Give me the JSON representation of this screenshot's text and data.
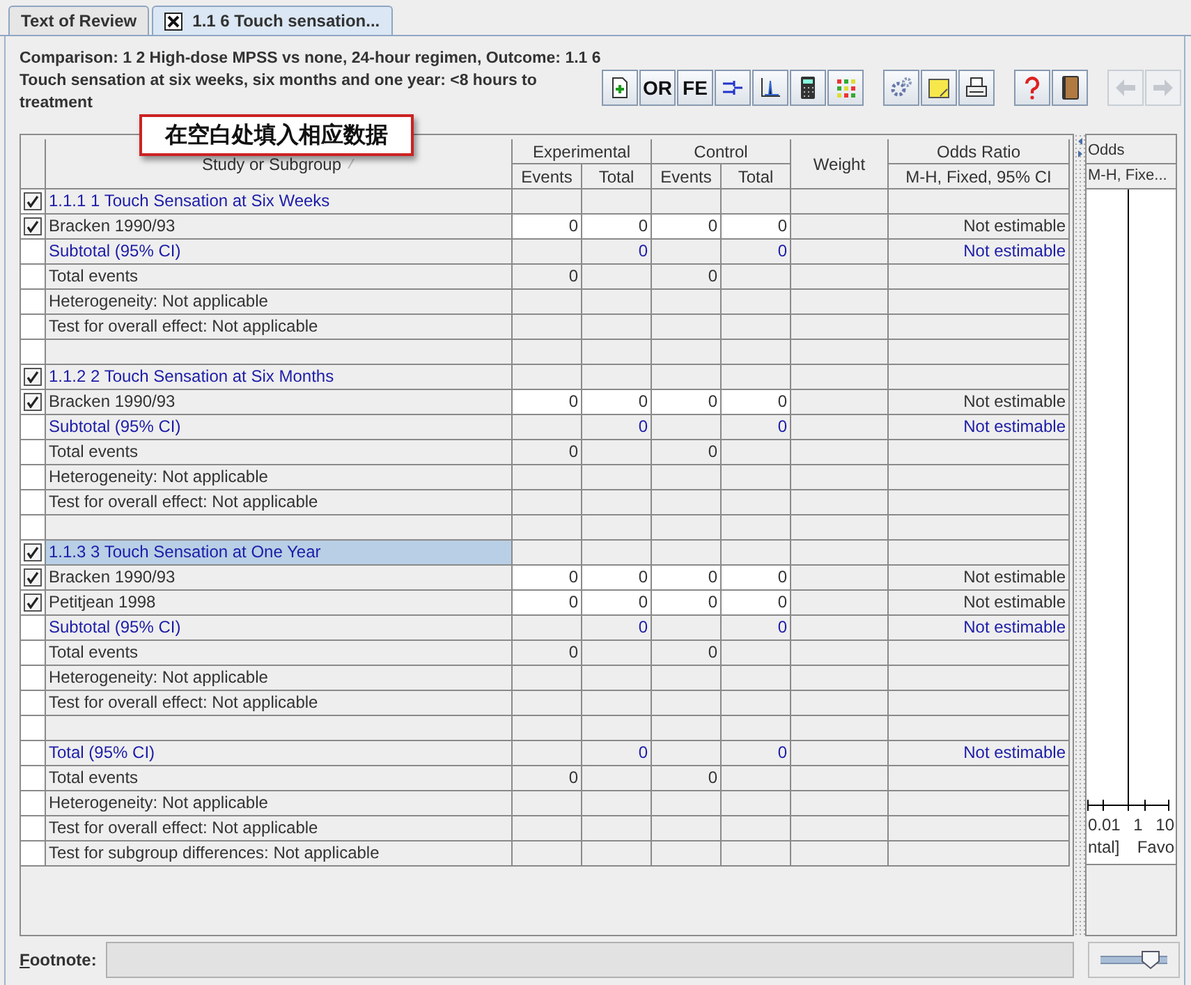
{
  "tabs": [
    {
      "label": "Text of Review",
      "selected": false,
      "closable": false
    },
    {
      "label": "1.1 6 Touch sensation...",
      "selected": true,
      "closable": true
    }
  ],
  "heading": "Comparison: 1 2 High-dose MPSS vs none, 24-hour regimen, Outcome: 1.1 6 Touch sensation at six weeks, six months and one year: <8 hours to treatment",
  "callout": "在空白处填入相应数据",
  "toolbar": {
    "text_buttons": [
      {
        "label": "OR"
      },
      {
        "label": "FE"
      }
    ],
    "navigation": [
      {
        "disabled": true
      },
      {
        "disabled": true
      }
    ]
  },
  "table": {
    "columns": {
      "study": "Study or Subgroup",
      "experimental": "Experimental",
      "control": "Control",
      "experimental_events": "Events",
      "experimental_total": "Total",
      "control_events": "Events",
      "control_total": "Total",
      "weight": "Weight",
      "odds_ratio": "Odds Ratio",
      "method": "M-H, Fixed, 95% CI"
    },
    "rows": [
      {
        "kind": "group",
        "label": "1.1.1 1 Touch Sensation at Six Weeks",
        "checked": true,
        "selected": false
      },
      {
        "kind": "study",
        "label": "Bracken 1990/93",
        "checked": true,
        "exp_events": "0",
        "exp_total": "0",
        "ctrl_events": "0",
        "ctrl_total": "0",
        "odds_ratio": "Not estimable"
      },
      {
        "kind": "subtotal",
        "label": "Subtotal (95% CI)",
        "exp_total": "0",
        "ctrl_total": "0",
        "odds_ratio": "Not estimable"
      },
      {
        "kind": "plain",
        "label": "Total events",
        "exp_events": "0",
        "ctrl_events": "0"
      },
      {
        "kind": "plain",
        "label": "Heterogeneity: Not applicable"
      },
      {
        "kind": "plain",
        "label": "Test for overall effect: Not applicable"
      },
      {
        "kind": "blank"
      },
      {
        "kind": "group",
        "label": "1.1.2 2 Touch Sensation at Six Months",
        "checked": true,
        "selected": false
      },
      {
        "kind": "study",
        "label": "Bracken 1990/93",
        "checked": true,
        "exp_events": "0",
        "exp_total": "0",
        "ctrl_events": "0",
        "ctrl_total": "0",
        "odds_ratio": "Not estimable"
      },
      {
        "kind": "subtotal",
        "label": "Subtotal (95% CI)",
        "exp_total": "0",
        "ctrl_total": "0",
        "odds_ratio": "Not estimable"
      },
      {
        "kind": "plain",
        "label": "Total events",
        "exp_events": "0",
        "ctrl_events": "0"
      },
      {
        "kind": "plain",
        "label": "Heterogeneity: Not applicable"
      },
      {
        "kind": "plain",
        "label": "Test for overall effect: Not applicable"
      },
      {
        "kind": "blank"
      },
      {
        "kind": "group",
        "label": "1.1.3 3 Touch Sensation at One Year",
        "checked": true,
        "selected": true
      },
      {
        "kind": "study",
        "label": "Bracken 1990/93",
        "checked": true,
        "exp_events": "0",
        "exp_total": "0",
        "ctrl_events": "0",
        "ctrl_total": "0",
        "odds_ratio": "Not estimable"
      },
      {
        "kind": "study",
        "label": "Petitjean 1998",
        "checked": true,
        "exp_events": "0",
        "exp_total": "0",
        "ctrl_events": "0",
        "ctrl_total": "0",
        "odds_ratio": "Not estimable"
      },
      {
        "kind": "subtotal",
        "label": "Subtotal (95% CI)",
        "exp_total": "0",
        "ctrl_total": "0",
        "odds_ratio": "Not estimable"
      },
      {
        "kind": "plain",
        "label": "Total events",
        "exp_events": "0",
        "ctrl_events": "0"
      },
      {
        "kind": "plain",
        "label": "Heterogeneity: Not applicable"
      },
      {
        "kind": "plain",
        "label": "Test for overall effect: Not applicable"
      },
      {
        "kind": "blank"
      },
      {
        "kind": "subtotal",
        "label": "Total (95% CI)",
        "exp_total": "0",
        "ctrl_total": "0",
        "odds_ratio": "Not estimable"
      },
      {
        "kind": "plain",
        "label": "Total events",
        "exp_events": "0",
        "ctrl_events": "0"
      },
      {
        "kind": "plain",
        "label": "Heterogeneity: Not applicable"
      },
      {
        "kind": "plain",
        "label": "Test for overall effect: Not applicable"
      },
      {
        "kind": "plain",
        "label": "Test for subgroup differences: Not applicable"
      }
    ]
  },
  "plot": {
    "header": "Odds",
    "subheader": "M-H, Fixe...",
    "axis_labels": [
      "0.01",
      "1",
      "10"
    ],
    "captions": [
      "ntal]",
      "Favo"
    ]
  },
  "footnote": {
    "label": "Footnote:"
  },
  "zoom_slider": {
    "level": 0.75
  }
}
